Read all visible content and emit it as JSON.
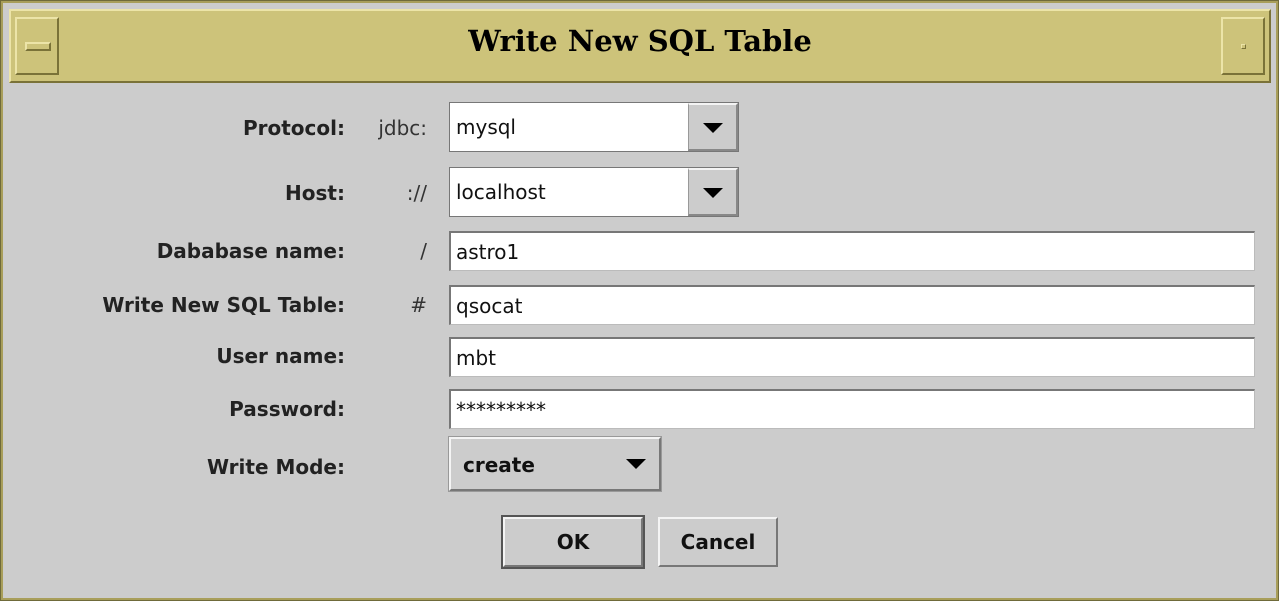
{
  "window": {
    "title": "Write New SQL Table"
  },
  "form": {
    "protocol": {
      "label": "Protocol:",
      "prefix": "jdbc:",
      "value": "mysql"
    },
    "host": {
      "label": "Host:",
      "prefix": "://",
      "value": "localhost"
    },
    "database": {
      "label": "Dababase name:",
      "prefix": "/",
      "value": "astro1"
    },
    "table": {
      "label": "Write New SQL Table:",
      "prefix": "#",
      "value": "qsocat"
    },
    "user": {
      "label": "User name:",
      "value": "mbt"
    },
    "password": {
      "label": "Password:",
      "value": "*********"
    },
    "mode": {
      "label": "Write Mode:",
      "value": "create"
    }
  },
  "buttons": {
    "ok": "OK",
    "cancel": "Cancel"
  }
}
